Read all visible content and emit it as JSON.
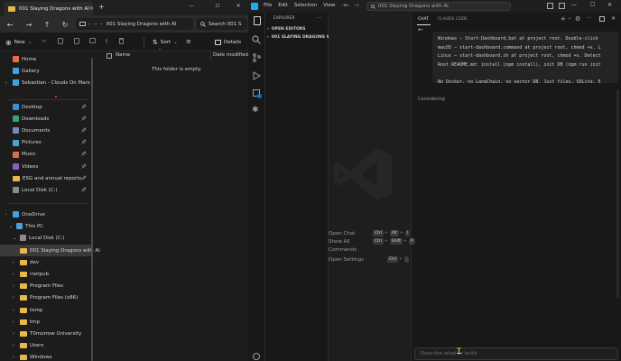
{
  "explorer": {
    "tab_title": "001 Slaying Dragons with AI",
    "new_tab": "+",
    "window_controls": {
      "minimize": "—",
      "maximize": "☐",
      "close": "✕"
    },
    "nav_buttons": {
      "back": "←",
      "forward": "→",
      "up": "↑",
      "refresh": "↻"
    },
    "address": {
      "overflow": "···",
      "path": "001 Slaying Dragons with AI"
    },
    "search_placeholder": "Search 001 S",
    "toolbar": {
      "new_label": "New",
      "sort_label": "Sort",
      "details_label": "Details"
    },
    "columns": {
      "name": "Name",
      "date_modified": "Date modified"
    },
    "empty_message": "This folder is empty.",
    "nav": {
      "quick": [
        {
          "label": "Home",
          "color": "#e86f3d"
        },
        {
          "label": "Gallery",
          "color": "#3fa2e3"
        },
        {
          "label": "Sebastian - Clouds On Mars",
          "color": "#3fa2e3"
        }
      ],
      "pinned": [
        {
          "label": "Desktop",
          "color": "#3b8fd6"
        },
        {
          "label": "Downloads",
          "color": "#37a36b"
        },
        {
          "label": "Documents",
          "color": "#6f8db8"
        },
        {
          "label": "Pictures",
          "color": "#4aa0d9"
        },
        {
          "label": "Music",
          "color": "#e0694b"
        },
        {
          "label": "Videos",
          "color": "#8a5cc8"
        },
        {
          "label": "ESG and annual reports",
          "color": "#e8b84b"
        },
        {
          "label": "Local Disk (C:)",
          "color": "#8a8a8a"
        }
      ],
      "tree_top": [
        {
          "label": "OneDrive",
          "color": "#3fa2e3"
        },
        {
          "label": "This PC",
          "color": "#4aa0d9"
        },
        {
          "label": "Local Disk (C:)",
          "color": "#8a8a8a"
        }
      ],
      "folders": [
        "001 Slaying Dragons with AI",
        "dev",
        "inetpub",
        "Program Files",
        "Program Files (x86)",
        "temp",
        "tmp",
        "T0morrow University",
        "Users",
        "Windows"
      ]
    }
  },
  "vscode": {
    "menu": [
      "File",
      "Edit",
      "Selection",
      "View",
      "···"
    ],
    "command_center": "001 Slaying Dragons with AI",
    "sidebar": {
      "title": "EXPLORER",
      "overflow": "···",
      "open_editors": "OPEN EDITORS",
      "folder": "001 SLAYING DRAGONS WI..."
    },
    "shortcuts": [
      {
        "label": "Open Chat",
        "keys": [
          "Ctrl",
          "+",
          "Alt",
          "+",
          "I"
        ]
      },
      {
        "label": "Show All Commands",
        "keys": [
          "Ctrl",
          "+",
          "Shift",
          "+",
          "P"
        ]
      },
      {
        "label": "Open Settings",
        "keys": [
          "Ctrl",
          "+",
          ","
        ]
      }
    ],
    "chat": {
      "tabs": [
        "CHAT",
        "CLAUDE CODE"
      ],
      "code_lines": [
        "Windows — Start-Dashboard.bat at project root. Double-click",
        "macOS — start-dashboard.command at project root, chmod +x. L",
        "Linux — start-dashboard.sh at project root, chmod +x. Detect",
        "Root README.md: install (npm install), init DB (npm run init",
        "",
        "No Docker, no LangChain, no vector DB. Just files, SQLite, E"
      ],
      "status": "Considering",
      "input_placeholder": "Describe what to build"
    }
  },
  "colors": {
    "accent": "#0078d4",
    "folder": "#e8b84b",
    "bg_dark": "#1e1e1e"
  }
}
